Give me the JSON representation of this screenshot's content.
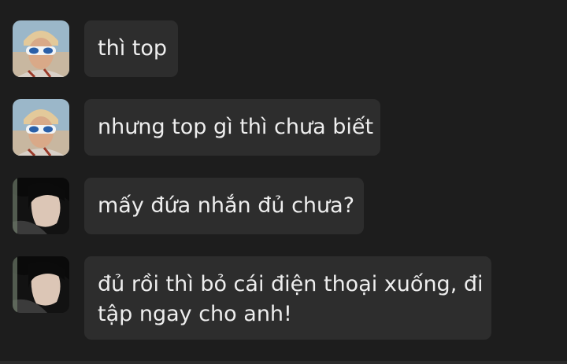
{
  "messages": [
    {
      "sender": "user-a",
      "lines": [
        "thì top"
      ]
    },
    {
      "sender": "user-a",
      "lines": [
        "nhưng top gì thì chưa biết"
      ]
    },
    {
      "sender": "user-b",
      "lines": [
        "mấy đứa nhắn đủ chưa?"
      ]
    },
    {
      "sender": "user-b",
      "lines": [
        "đủ rồi thì bỏ cái điện thoại xuống, đi",
        "tập ngay cho anh!"
      ]
    }
  ],
  "colors": {
    "background": "#1d1d1d",
    "bubble": "#2d2d2d",
    "text": "#eeeeee"
  },
  "icons": {
    "user-a": "avatar-sunglasses-photo",
    "user-b": "avatar-profile-photo"
  }
}
